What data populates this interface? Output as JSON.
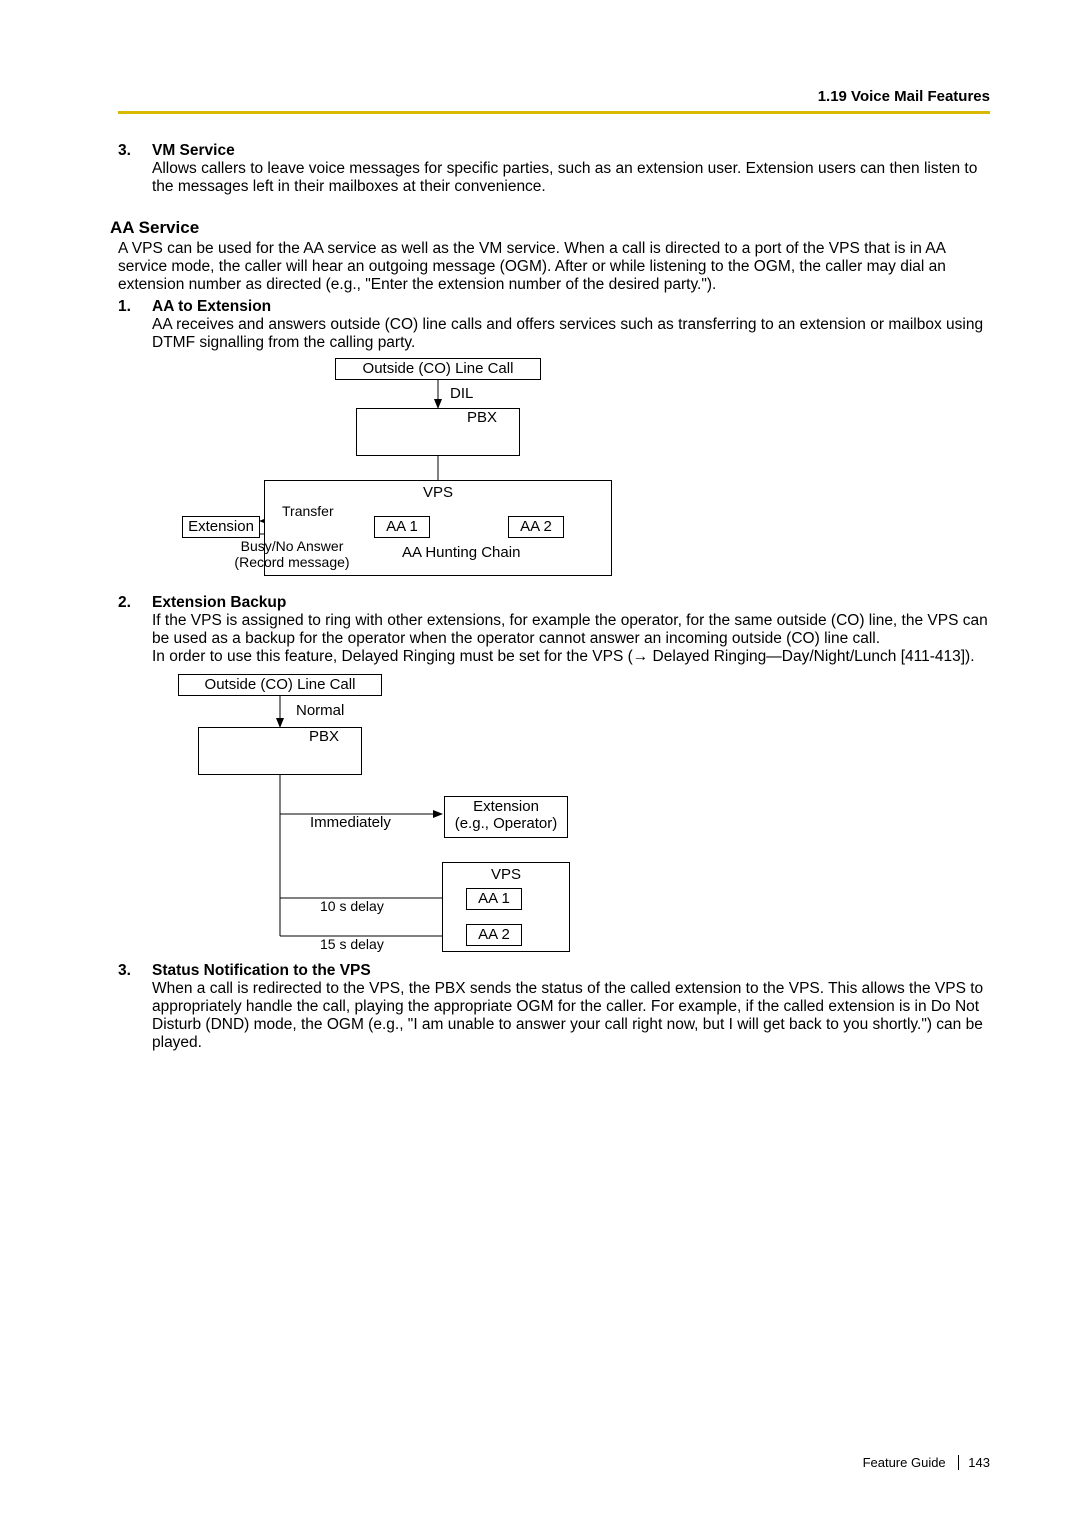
{
  "header": {
    "section": "1.19 Voice Mail Features"
  },
  "item3": {
    "num": "3.",
    "title": "VM Service",
    "body": "Allows callers to leave voice messages for specific parties, such as an extension user. Extension users can then listen to the messages left in their mailboxes at their convenience."
  },
  "aa": {
    "heading": "AA Service",
    "intro": "A VPS can be used for the AA service as well as the VM service. When a call is directed to a port of the VPS that is in AA service mode, the caller will hear an outgoing message (OGM). After or while listening to the OGM, the caller may dial an extension number as directed (e.g., \"Enter the extension number of the desired party.\").",
    "i1": {
      "num": "1.",
      "title": "AA to Extension",
      "body": "AA receives and answers outside (CO) line calls and offers services such as transferring to an extension or mailbox using DTMF signalling from the calling party."
    },
    "i2": {
      "num": "2.",
      "title": "Extension Backup",
      "body1": "If the VPS is assigned to ring with other extensions, for example the operator, for the same outside (CO) line, the VPS can be used as a backup for the operator when the operator cannot answer an incoming outside (CO) line call.",
      "body2a": "In order to use this feature, Delayed Ringing must be set for the VPS (",
      "body2b": " Delayed Ringing—Day/Night/Lunch [411-413])."
    },
    "i3": {
      "num": "3.",
      "title": "Status Notification to the VPS",
      "body": "When a call is redirected to the VPS, the PBX sends the status of the called extension to the VPS. This allows the VPS to appropriately handle the call, playing the appropriate OGM for the caller. For example, if the called extension is in Do Not Disturb (DND) mode, the OGM (e.g., \"I am unable to answer your call right now, but I will get back to you shortly.\") can be played."
    }
  },
  "dia1": {
    "co": "Outside (CO) Line Call",
    "dil": "DIL",
    "pbx": "PBX",
    "vps": "VPS",
    "aa1": "AA 1",
    "aa2": "AA 2",
    "chain": "AA Hunting Chain",
    "ext": "Extension",
    "transfer": "Transfer",
    "busy1": "Busy/No Answer",
    "busy2": "(Record message)"
  },
  "dia2": {
    "co": "Outside (CO) Line Call",
    "normal": "Normal",
    "pbx": "PBX",
    "imm": "Immediately",
    "ext1": "Extension",
    "ext2": "(e.g., Operator)",
    "vps": "VPS",
    "aa1": "AA 1",
    "aa2": "AA 2",
    "d10": "10 s delay",
    "d15": "15 s delay"
  },
  "footer": {
    "guide": "Feature Guide",
    "page": "143"
  }
}
